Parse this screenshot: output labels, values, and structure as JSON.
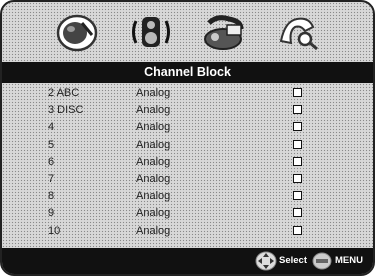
{
  "header": {
    "title": "Channel Block"
  },
  "icons": [
    "picture-settings-icon",
    "audio-settings-icon",
    "setup-icon",
    "parental-lock-icon"
  ],
  "channels": [
    {
      "number": "2 ABC",
      "type": "Analog"
    },
    {
      "number": "3 DISC",
      "type": "Analog"
    },
    {
      "number": "4",
      "type": "Analog"
    },
    {
      "number": "5",
      "type": "Analog"
    },
    {
      "number": "6",
      "type": "Analog"
    },
    {
      "number": "7",
      "type": "Analog"
    },
    {
      "number": "8",
      "type": "Analog"
    },
    {
      "number": "9",
      "type": "Analog"
    },
    {
      "number": "10",
      "type": "Analog"
    }
  ],
  "footer": {
    "select_label": "Select",
    "menu_label": "MENU"
  }
}
